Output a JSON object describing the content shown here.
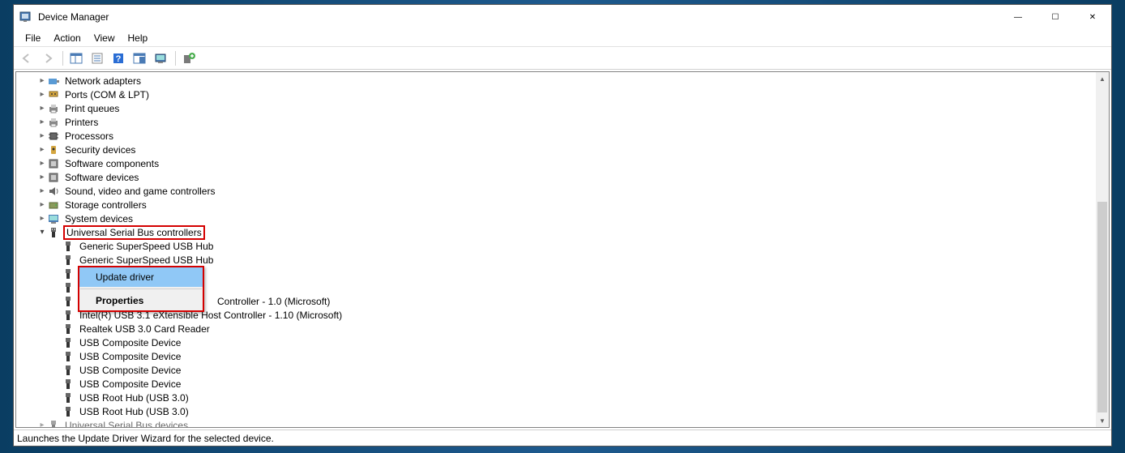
{
  "window": {
    "title": "Device Manager",
    "controls": {
      "min": "—",
      "max": "☐",
      "close": "✕"
    }
  },
  "menu": {
    "file": "File",
    "action": "Action",
    "view": "View",
    "help": "Help"
  },
  "toolbar": {
    "back": "back-icon",
    "forward": "forward-icon",
    "show_hide": "show-hide-icon",
    "properties": "properties-icon",
    "help": "help-icon",
    "update": "update-icon",
    "scan": "scan-icon",
    "add": "add-icon"
  },
  "tree": {
    "categories": [
      {
        "id": "network",
        "label": "Network adapters",
        "icon": "adapter"
      },
      {
        "id": "ports",
        "label": "Ports (COM & LPT)",
        "icon": "port"
      },
      {
        "id": "printq",
        "label": "Print queues",
        "icon": "printer"
      },
      {
        "id": "printers",
        "label": "Printers",
        "icon": "printer"
      },
      {
        "id": "processors",
        "label": "Processors",
        "icon": "chip"
      },
      {
        "id": "security",
        "label": "Security devices",
        "icon": "shield"
      },
      {
        "id": "swcomp",
        "label": "Software components",
        "icon": "software"
      },
      {
        "id": "swdev",
        "label": "Software devices",
        "icon": "software"
      },
      {
        "id": "sound",
        "label": "Sound, video and game controllers",
        "icon": "sound"
      },
      {
        "id": "storage",
        "label": "Storage controllers",
        "icon": "storage"
      },
      {
        "id": "sysdev",
        "label": "System devices",
        "icon": "system"
      }
    ],
    "usb": {
      "label": "Universal Serial Bus controllers",
      "children": [
        "Generic SuperSpeed USB Hub",
        "Generic SuperSpeed USB Hub",
        "",
        "",
        "Controller - 1.0 (Microsoft)",
        "Intel(R) USB 3.1 eXtensible Host Controller - 1.10 (Microsoft)",
        "Realtek USB 3.0 Card Reader",
        "USB Composite Device",
        "USB Composite Device",
        "USB Composite Device",
        "USB Composite Device",
        "USB Root Hub (USB 3.0)",
        "USB Root Hub (USB 3.0)"
      ]
    },
    "usb_devices": {
      "label": "Universal Serial Bus devices"
    }
  },
  "context_menu": {
    "update": "Update driver",
    "properties": "Properties"
  },
  "status": "Launches the Update Driver Wizard for the selected device."
}
